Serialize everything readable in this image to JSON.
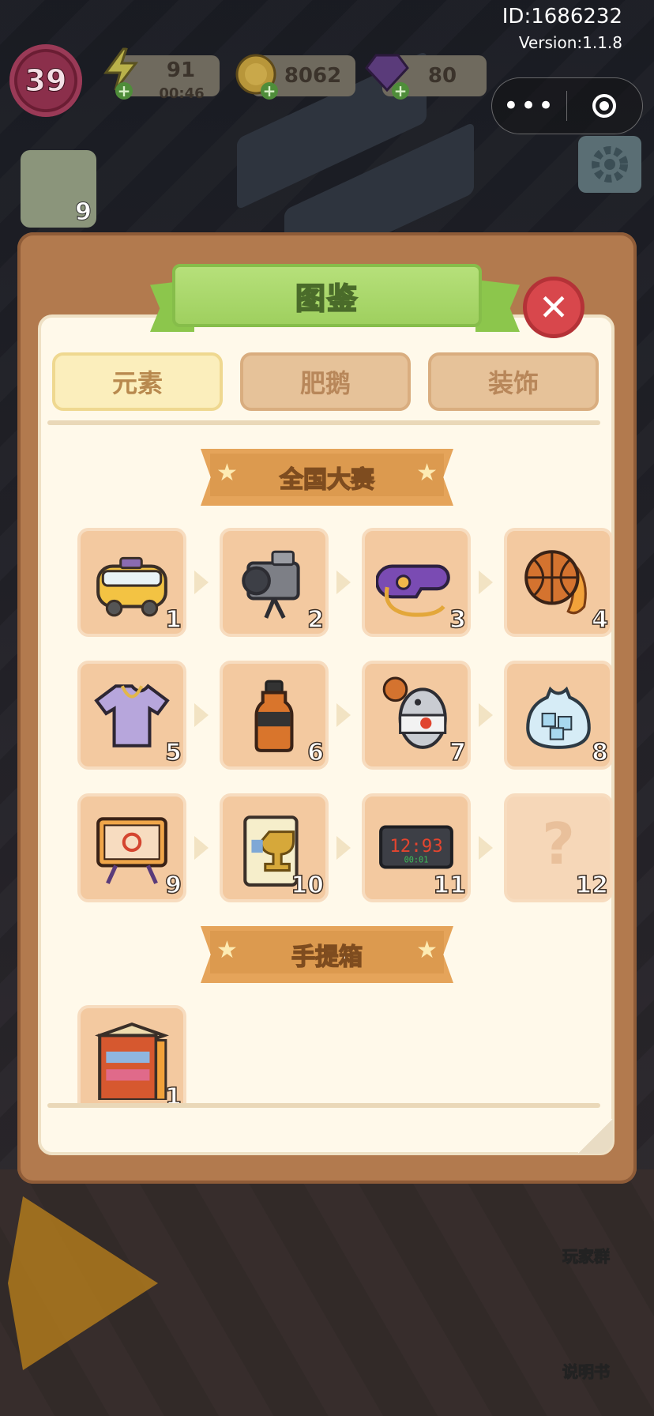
{
  "hud": {
    "level": "39",
    "energy": "91",
    "energy_timer": "00:46",
    "coins": "8062",
    "gems": "80",
    "clip_count": "9",
    "id_text": "ID:1686232",
    "version_text": "Version:1.1.8",
    "menu_dots": "•••"
  },
  "modal": {
    "title": "图鉴",
    "close_symbol": "✕",
    "tabs": [
      "元素",
      "肥鹅",
      "装饰"
    ],
    "sections": [
      {
        "title": "全国大赛",
        "items": [
          "1",
          "2",
          "3",
          "4",
          "5",
          "6",
          "7",
          "8",
          "9",
          "10",
          "11",
          "12"
        ]
      },
      {
        "title": "手提箱",
        "items": [
          "1"
        ]
      }
    ],
    "unknown_symbol": "?",
    "star": "★"
  },
  "side": {
    "players_group": "玩家群",
    "manual": "说明书"
  },
  "colors": {
    "modal_frame": "#b27a4e",
    "paper": "#fff9ea",
    "title_green": "#9fd05f",
    "close_red": "#d8474c",
    "tab_active": "#fbeebc",
    "tab_inactive": "#e6c299",
    "cell_bg": "#f3c9a0",
    "section_orange": "#dc9a4f"
  },
  "icons": {
    "1": "yellow-van-icon",
    "2": "video-camera-icon",
    "3": "whistle-icon",
    "4": "flaming-basketball-icon",
    "5": "jersey-icon",
    "6": "sports-drink-icon",
    "7": "mascot-fish-icon",
    "8": "ice-bag-icon",
    "9": "tactics-board-icon",
    "10": "trophy-box-icon",
    "11": "scoreboard-clock-icon",
    "12": "unknown-question-icon",
    "suitcase_1": "shoe-cabinet-icon"
  }
}
